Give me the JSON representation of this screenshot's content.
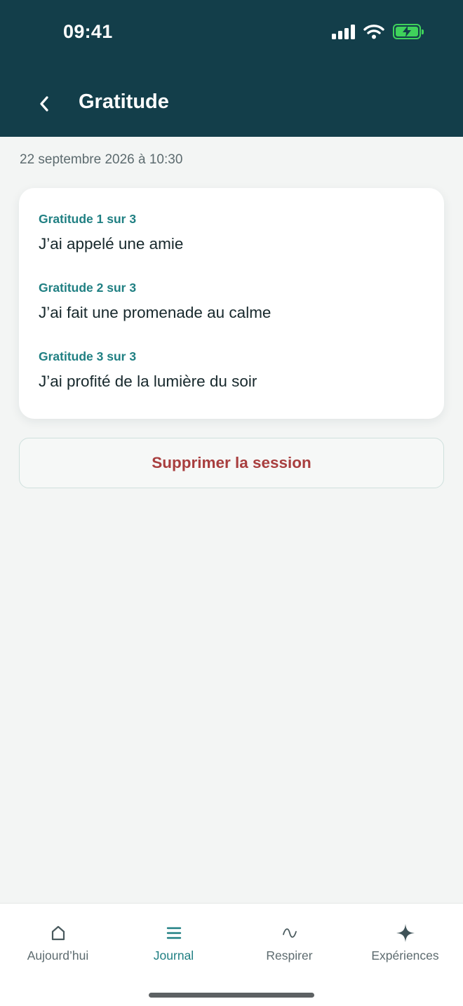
{
  "status_bar": {
    "time": "09:41"
  },
  "header": {
    "title": "Gratitude",
    "back_icon": "chevron-left-icon"
  },
  "session": {
    "date": "22 septembre 2026 à 10:30",
    "entries": [
      {
        "label": "Gratitude 1 sur 3",
        "text": "J’ai appelé une amie"
      },
      {
        "label": "Gratitude 2 sur 3",
        "text": "J’ai fait une promenade au calme"
      },
      {
        "label": "Gratitude 3 sur 3",
        "text": "J’ai profité de la lumière du soir"
      }
    ],
    "delete_label": "Supprimer la session"
  },
  "tabbar": {
    "tabs": [
      {
        "label": "Aujourd’hui",
        "icon": "home-icon",
        "active": false
      },
      {
        "label": "Journal",
        "icon": "list-icon",
        "active": true
      },
      {
        "label": "Respirer",
        "icon": "wave-icon",
        "active": false
      },
      {
        "label": "Expériences",
        "icon": "sparkle-icon",
        "active": false
      }
    ]
  },
  "colors": {
    "header_bg": "#133e4a",
    "accent": "#1f7f82",
    "danger": "#a83e3e",
    "battery": "#3fd25b",
    "background": "#f3f5f4"
  }
}
